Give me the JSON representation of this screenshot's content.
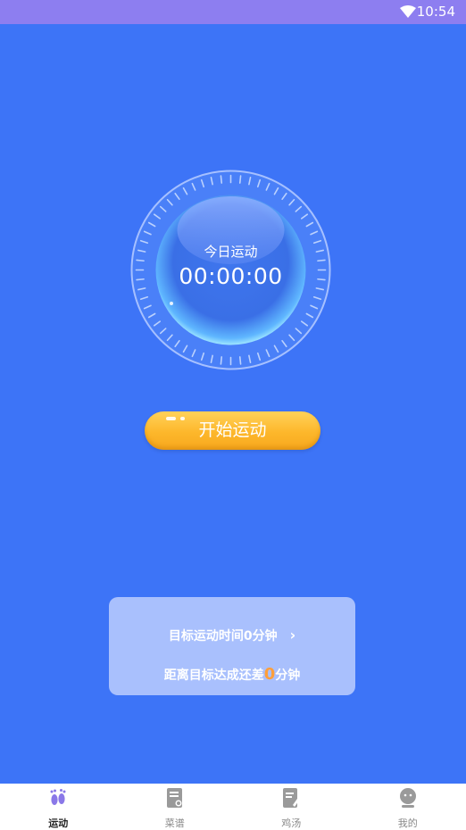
{
  "status_bar": {
    "time": "10:54"
  },
  "dial": {
    "title": "今日运动",
    "timer": "00:00:00"
  },
  "start_button": {
    "label": "开始运动"
  },
  "goal": {
    "target_text": "目标运动时间0分钟",
    "remaining_prefix": "距离目标达成还差",
    "remaining_value": "0",
    "remaining_suffix": "分钟"
  },
  "tabs": [
    {
      "label": "运动",
      "icon": "footprints-icon",
      "active": true
    },
    {
      "label": "菜谱",
      "icon": "recipe-icon",
      "active": false
    },
    {
      "label": "鸡汤",
      "icon": "notes-icon",
      "active": false
    },
    {
      "label": "我的",
      "icon": "profile-icon",
      "active": false
    }
  ],
  "colors": {
    "background": "#3d74f7",
    "status_bar": "#8d7ef0",
    "accent_orange": "#fdb72b",
    "active_tab_icon": "#8a78e8"
  }
}
